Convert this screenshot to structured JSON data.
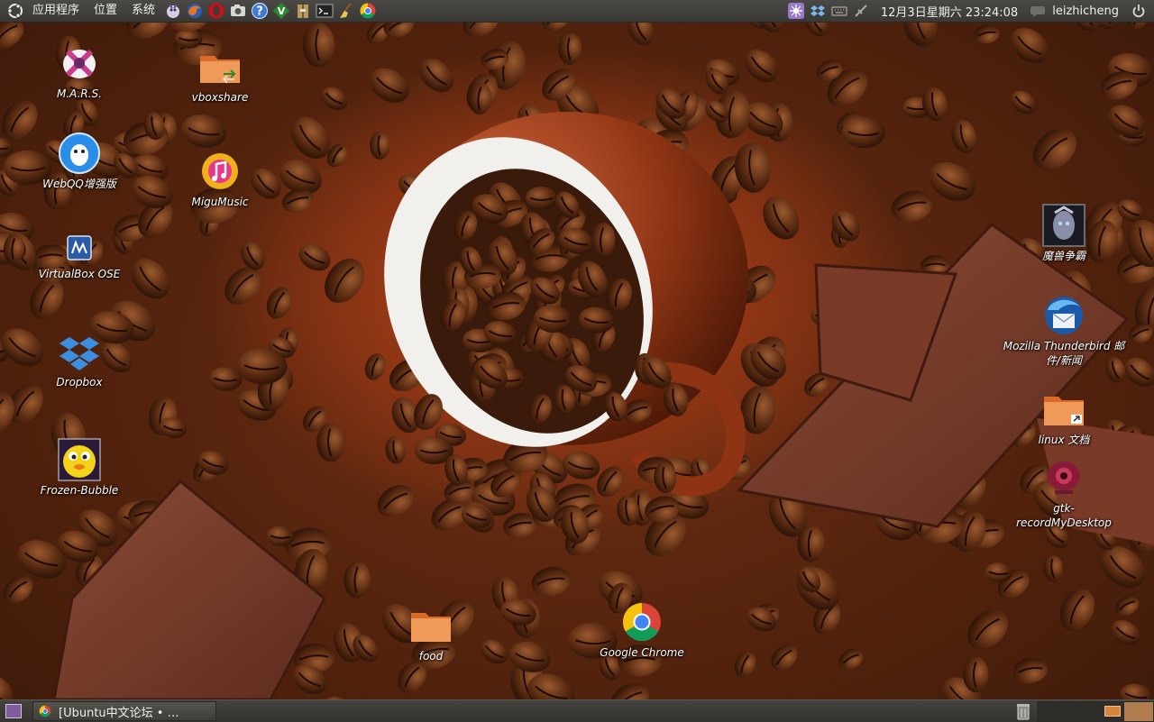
{
  "top_panel": {
    "menus": [
      "应用程序",
      "位置",
      "系统"
    ],
    "launchers": [
      "pidgin-icon",
      "firefox-icon",
      "opera-icon",
      "screenshot-icon",
      "help-icon",
      "vim-icon",
      "archive-manager-icon",
      "terminal-icon",
      "cleaner-broom-icon",
      "chrome-icon"
    ],
    "clock": "12月3日星期六 23:24:08",
    "user": "leizhicheng"
  },
  "desktop": {
    "icons_left": [
      {
        "label": "M.A.R.S.",
        "icon": "mars-icon"
      },
      {
        "label": "WebQQ增强版",
        "icon": "webqq-icon"
      },
      {
        "label": "VirtualBox OSE",
        "icon": "virtualbox-icon"
      },
      {
        "label": "Dropbox",
        "icon": "dropbox-icon"
      },
      {
        "label": "Frozen-Bubble",
        "icon": "frozen-bubble-icon"
      }
    ],
    "icons_mid": [
      {
        "label": "vboxshare",
        "icon": "folder-link-icon"
      },
      {
        "label": "MiguMusic",
        "icon": "migumusic-icon"
      }
    ],
    "icons_right": [
      {
        "label": "魔兽争霸",
        "icon": "warcraft-icon"
      },
      {
        "label": "Mozilla Thunderbird 邮件/新闻",
        "icon": "thunderbird-icon"
      },
      {
        "label": "linux 文档",
        "icon": "folder-link-icon"
      },
      {
        "label": "gtk-recordMyDesktop",
        "icon": "record-desktop-icon"
      }
    ],
    "icons_bottom": [
      {
        "label": "food",
        "icon": "folder-icon"
      },
      {
        "label": "Google Chrome",
        "icon": "chrome-icon"
      }
    ]
  },
  "bottom_panel": {
    "task": "[Ubuntu中文论坛 • …",
    "workspaces": 4,
    "active_workspace": 4
  },
  "colors": {
    "panel": "#3c3b37",
    "folder": "#e8874a",
    "accent": "#dd4814"
  }
}
